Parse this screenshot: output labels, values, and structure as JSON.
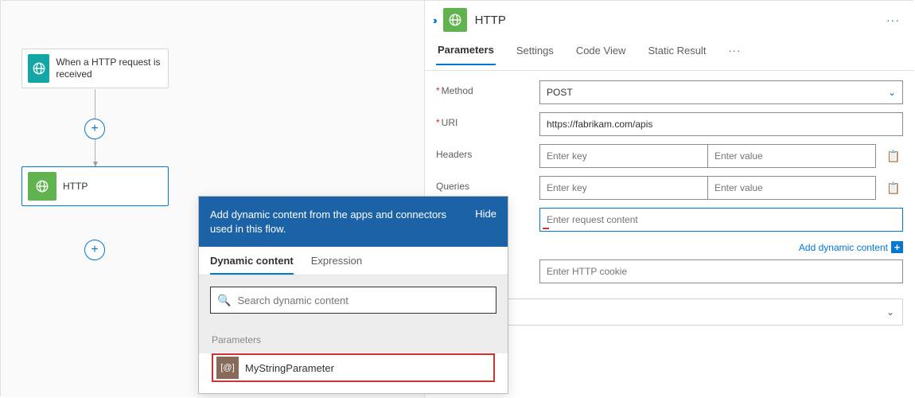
{
  "canvas": {
    "trigger": {
      "label": "When a HTTP request is received"
    },
    "action": {
      "label": "HTTP"
    }
  },
  "panel": {
    "title": "HTTP",
    "tabs": {
      "parameters": "Parameters",
      "settings": "Settings",
      "code_view": "Code View",
      "static_result": "Static Result"
    },
    "form": {
      "method_label": "Method",
      "method_value": "POST",
      "uri_label": "URI",
      "uri_value": "https://fabrikam.com/apis",
      "headers_label": "Headers",
      "queries_label": "Queries",
      "key_placeholder": "Enter key",
      "value_placeholder": "Enter value",
      "body_placeholder": "Enter request content",
      "cookie_placeholder": "Enter HTTP cookie",
      "add_dynamic": "Add dynamic content"
    }
  },
  "popup": {
    "message": "Add dynamic content from the apps and connectors used in this flow.",
    "hide": "Hide",
    "tabs": {
      "dynamic": "Dynamic content",
      "expression": "Expression"
    },
    "search_placeholder": "Search dynamic content",
    "section_title": "Parameters",
    "item_label": "MyStringParameter"
  }
}
